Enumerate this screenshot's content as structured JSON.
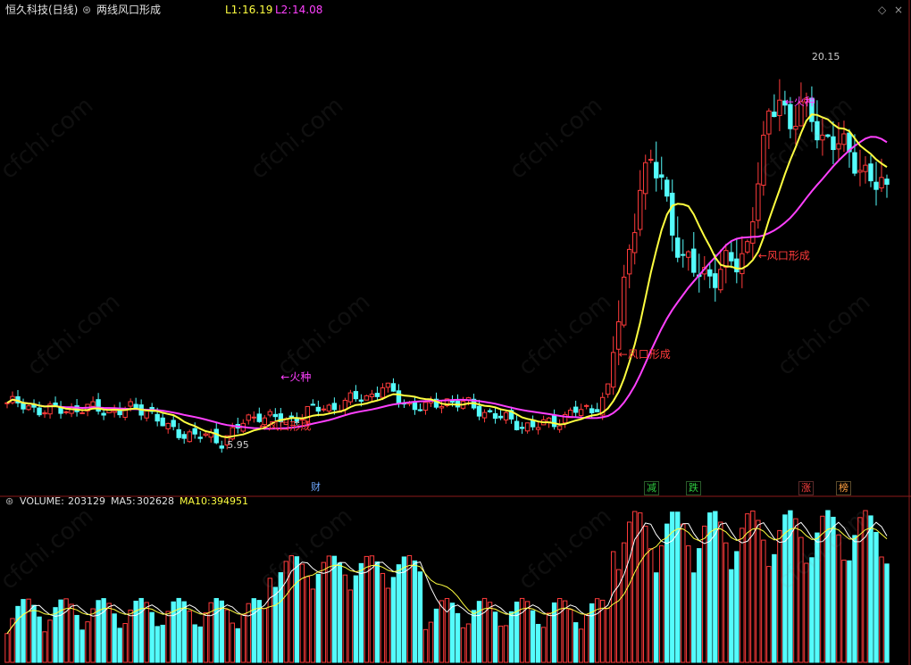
{
  "header": {
    "stock_name": "恒久科技",
    "period": "(日线)",
    "indicator_name": "两线风口形成",
    "l1_label": "L1:",
    "l1_value": "16.19",
    "l2_label": "L2:",
    "l2_value": "14.08"
  },
  "volume_header": {
    "volume_label": "VOLUME:",
    "volume_value": "203129",
    "ma5_label": "MA5:",
    "ma5_value": "302628",
    "ma10_label": "MA10:",
    "ma10_value": "394951"
  },
  "event_markers": [
    {
      "label": "财",
      "color": "#6fa8ff"
    },
    {
      "label": "减",
      "color": "#2ecc40"
    },
    {
      "label": "跌",
      "color": "#2ecc40"
    },
    {
      "label": "涨",
      "color": "#ff4040"
    },
    {
      "label": "榜",
      "color": "#ffa040"
    }
  ],
  "watermark": "cfchi.com",
  "colors": {
    "up": "#ff3b3b",
    "down": "#54fcfc",
    "l1": "#ffff40",
    "l2": "#ff40ff",
    "background": "#000000",
    "text": "#cccccc"
  },
  "chart_data": [
    {
      "type": "candlestick",
      "title": "两线风口形成",
      "price_range": [
        4.2,
        21.5
      ],
      "high_label": "20.15",
      "low_label": "5.95",
      "signal_labels": {
        "fengkou": "←风口形成",
        "huozhong": "←火种"
      },
      "series": [
        {
          "name": "L1",
          "last_value": 16.19
        },
        {
          "name": "L2",
          "last_value": 14.08
        }
      ],
      "key_points": [
        {
          "label": "low",
          "value": 5.95
        },
        {
          "label": "high",
          "value": 20.15
        }
      ]
    },
    {
      "type": "bar",
      "title": "VOLUME",
      "series": [
        {
          "name": "VOLUME",
          "last_value": 203129
        },
        {
          "name": "MA5",
          "last_value": 302628
        },
        {
          "name": "MA10",
          "last_value": 394951
        }
      ]
    }
  ]
}
